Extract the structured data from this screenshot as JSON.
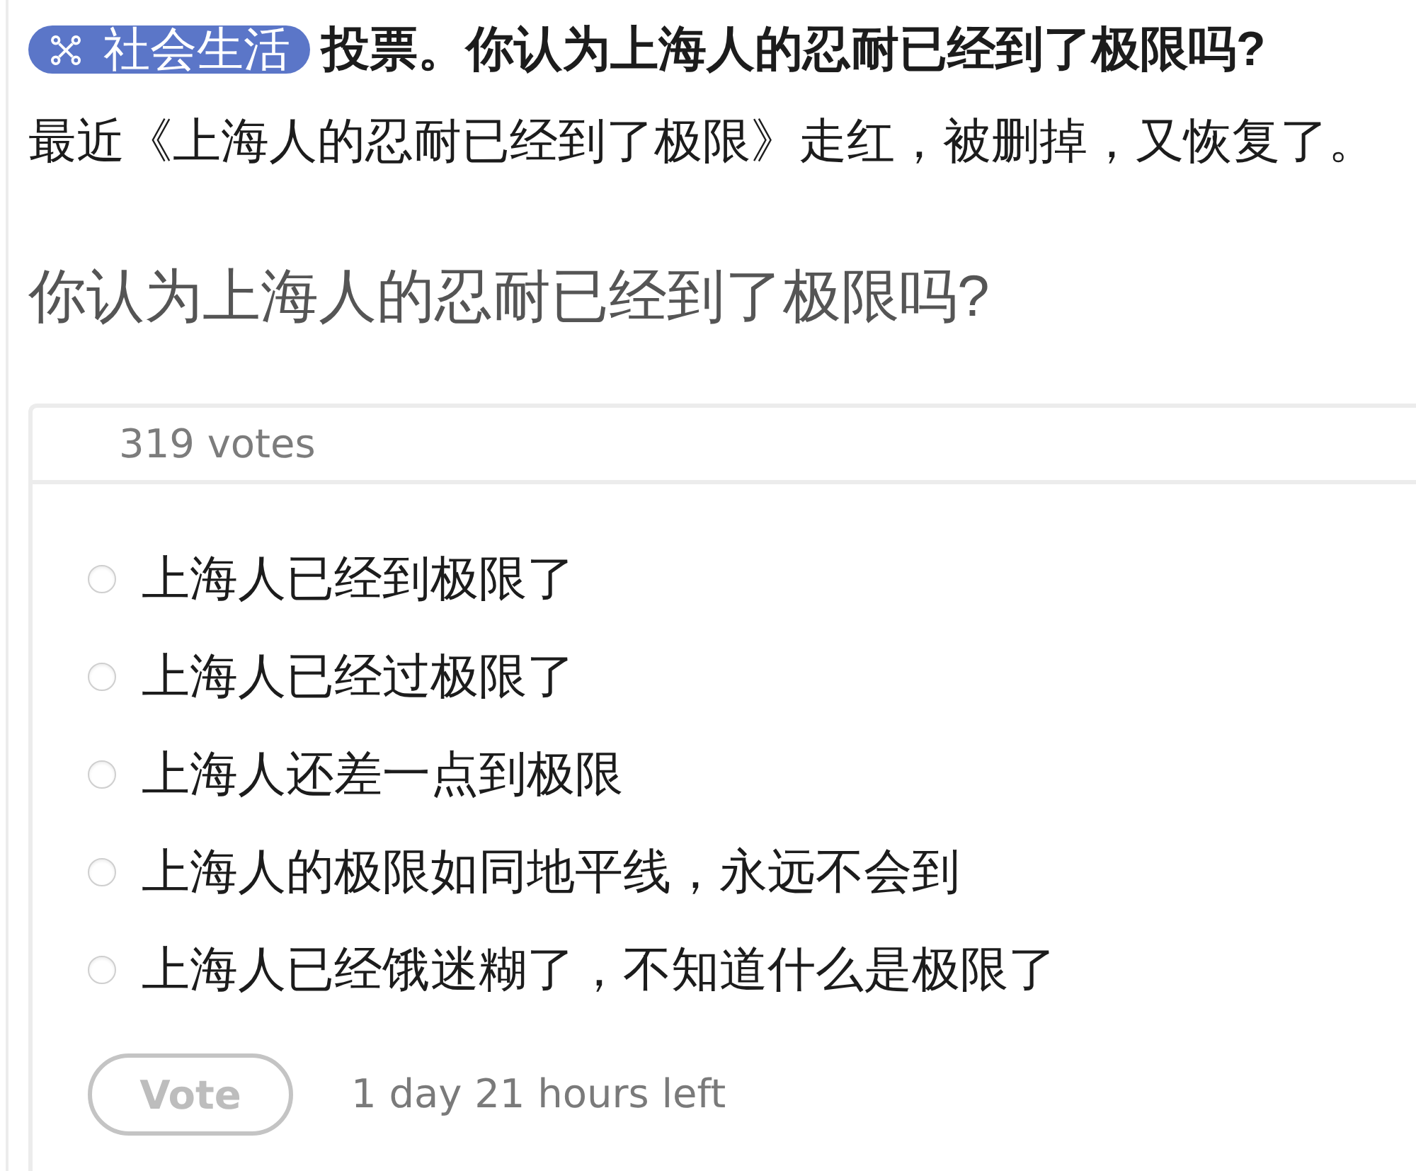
{
  "post": {
    "flair": {
      "label": "社会生活"
    },
    "title": "投票。你认为上海人的忍耐已经到了极限吗?",
    "body": "最近《上海人的忍耐已经到了极限》走红，被删掉，又恢复了。",
    "question": "你认为上海人的忍耐已经到了极限吗?"
  },
  "poll": {
    "votes": "319 votes",
    "options": [
      {
        "label": "上海人已经到极限了",
        "selected": false
      },
      {
        "label": "上海人已经过极限了",
        "selected": false
      },
      {
        "label": "上海人还差一点到极限",
        "selected": false
      },
      {
        "label": "上海人的极限如同地平线，永远不会到",
        "selected": false
      },
      {
        "label": "上海人已经饿迷糊了，不知道什么是极限了",
        "selected": false
      }
    ],
    "vote_button": {
      "label": "Vote",
      "disabled": true
    },
    "time_left": "1 day 21 hours left"
  }
}
